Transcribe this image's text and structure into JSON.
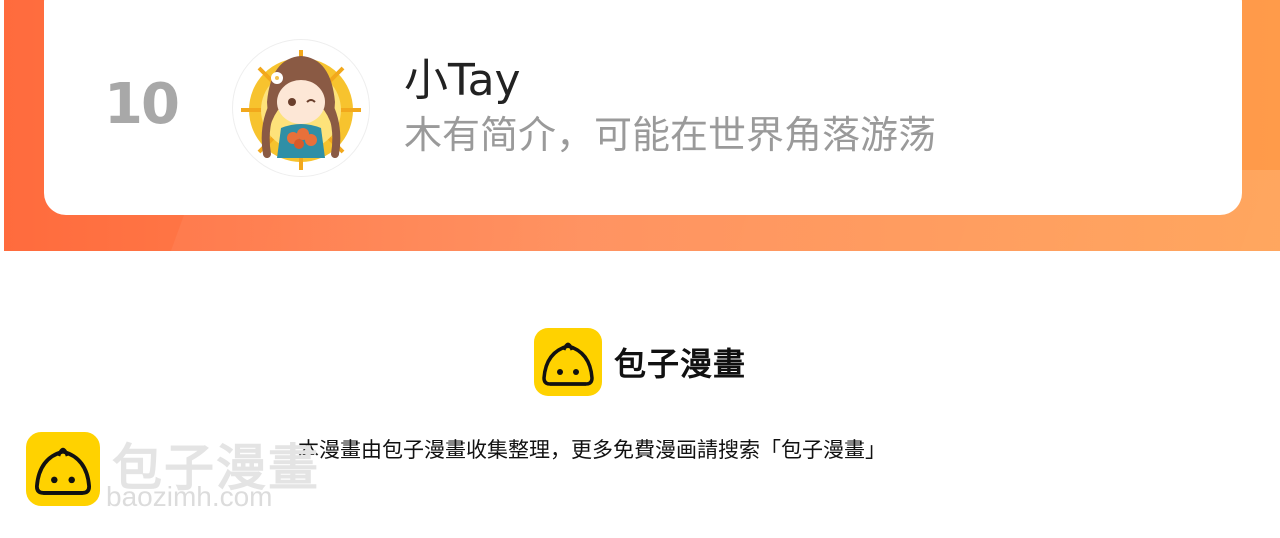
{
  "ranking_entry": {
    "rank": "10",
    "username": "小Tay",
    "bio": "木有简介，可能在世界角落游荡"
  },
  "footer": {
    "brand_name": "包子漫畫",
    "notice": "本漫畫由包子漫畫收集整理，更多免費漫画請搜索「包子漫畫」"
  },
  "watermark": {
    "name": "包子漫畫",
    "url": "baozimh.com"
  },
  "colors": {
    "band_start": "#ff6b3d",
    "band_end": "#ff9b4a",
    "brand_yellow": "#ffd200"
  },
  "icons": {
    "avatar": "anime-girl-avatar",
    "brand": "bun-logo-icon"
  }
}
